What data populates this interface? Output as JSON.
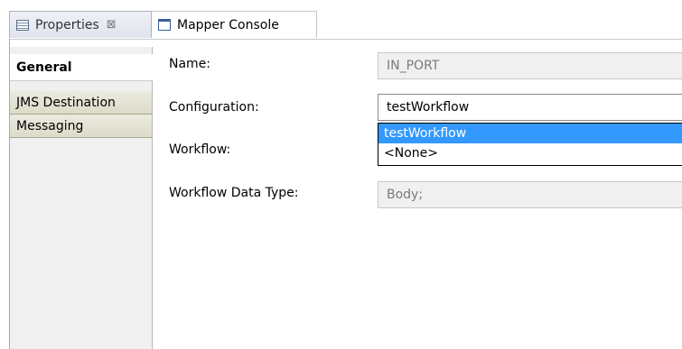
{
  "tabs": [
    {
      "label": "Properties",
      "close": "⊠"
    },
    {
      "label": "Mapper Console"
    }
  ],
  "sidebar": {
    "items": [
      {
        "label": "General"
      },
      {
        "label": "JMS Destination"
      },
      {
        "label": "Messaging"
      }
    ]
  },
  "form": {
    "name": {
      "label": "Name:",
      "value": "IN_PORT"
    },
    "configuration": {
      "label": "Configuration:",
      "value": "testWorkflow"
    },
    "workflow": {
      "label": "Workflow:"
    },
    "workflow_data_type": {
      "label": "Workflow Data Type:",
      "value": "Body;"
    }
  },
  "dropdown": {
    "options": [
      "testWorkflow",
      "<None>"
    ]
  },
  "colors": {
    "selection": "#3399ff",
    "sidebar_bg": "#f0f0f0",
    "sidebar_tab": "#dcdac8"
  }
}
